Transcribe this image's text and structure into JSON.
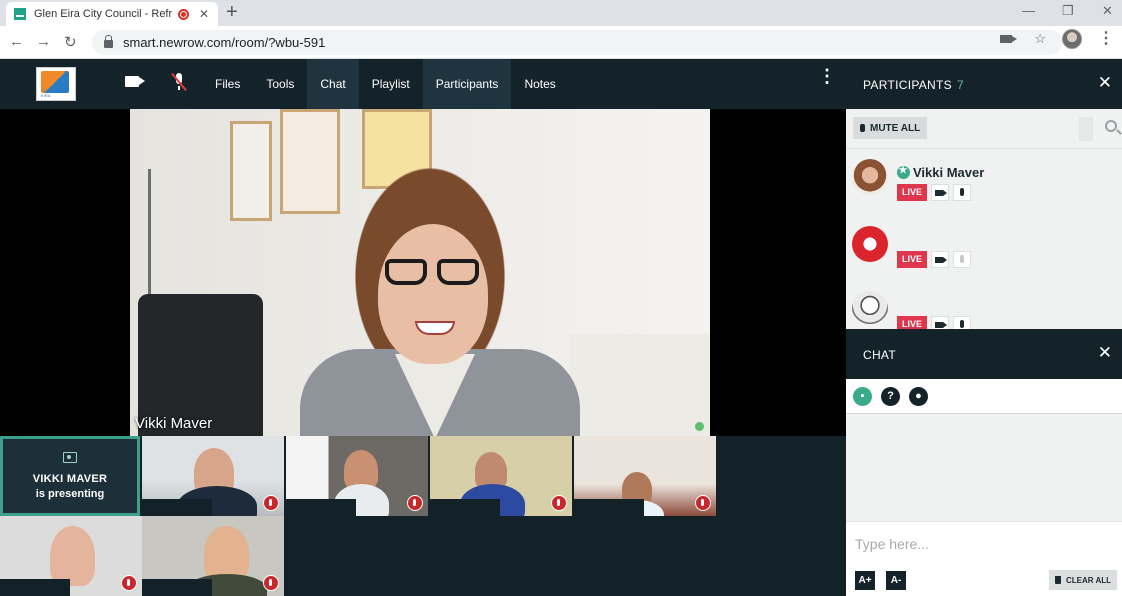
{
  "browser": {
    "tab_title": "Glen Eira City Council - Refre",
    "url": "smart.newrow.com/room/?wbu-591",
    "new_tab_symbol": "+",
    "tab_close_symbol": "✕"
  },
  "app": {
    "logo_text": "CITY OF GLEN EIRA",
    "menu": [
      {
        "label": "Files",
        "active": false
      },
      {
        "label": "Tools",
        "active": false
      },
      {
        "label": "Chat",
        "active": true
      },
      {
        "label": "Playlist",
        "active": false
      },
      {
        "label": "Participants",
        "active": true
      },
      {
        "label": "Notes",
        "active": false
      }
    ]
  },
  "stage": {
    "presenter_name": "Vikki Maver"
  },
  "thumbnails": {
    "presenting_name": "VIKKI MAVER",
    "presenting_sub": "is presenting"
  },
  "participants_panel": {
    "title": "PARTICIPANTS",
    "count": "7",
    "mute_all": "MUTE ALL",
    "list": [
      {
        "name": "Vikki Maver",
        "live": "LIVE",
        "mic_muted": false
      },
      {
        "name": "",
        "live": "LIVE",
        "mic_muted": true
      },
      {
        "name": "",
        "live": "LIVE",
        "mic_muted": false
      }
    ]
  },
  "chat_panel": {
    "title": "CHAT",
    "placeholder": "Type here...",
    "font_up": "A+",
    "font_down": "A-",
    "clear_all": "CLEAR ALL",
    "help_symbol": "?"
  },
  "colors": {
    "accent_green": "#3aaa8b",
    "live_red": "#e0364b",
    "header_dark": "#142229"
  }
}
